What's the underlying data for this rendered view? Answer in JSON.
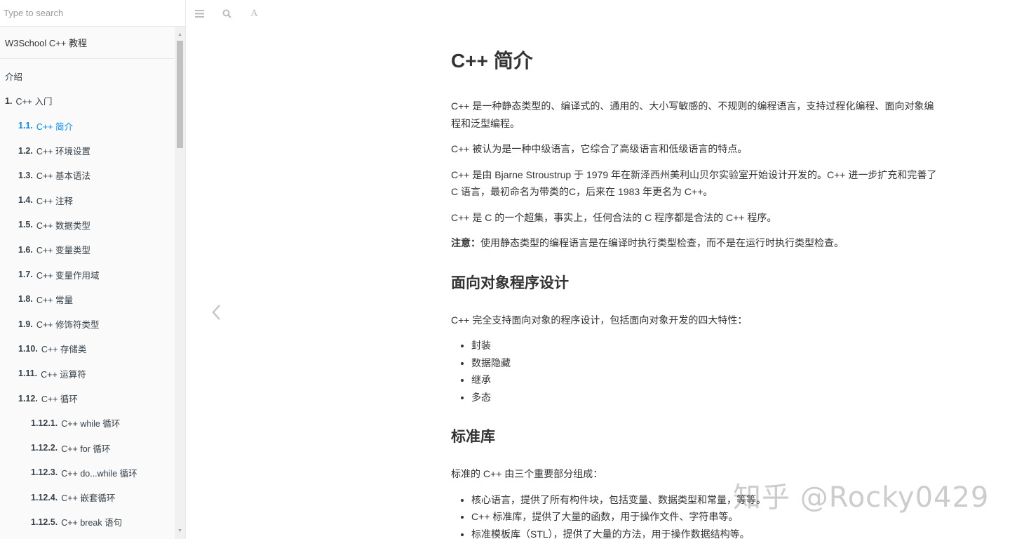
{
  "search": {
    "placeholder": "Type to search"
  },
  "sidebar": {
    "book_title": "W3School C++ 教程",
    "items": [
      {
        "num": "",
        "label": "介绍",
        "level": 0,
        "active": false
      },
      {
        "num": "1.",
        "label": "C++ 入门",
        "level": 0,
        "active": false
      },
      {
        "num": "1.1.",
        "label": "C++ 简介",
        "level": 1,
        "active": true
      },
      {
        "num": "1.2.",
        "label": "C++ 环境设置",
        "level": 1,
        "active": false
      },
      {
        "num": "1.3.",
        "label": "C++ 基本语法",
        "level": 1,
        "active": false
      },
      {
        "num": "1.4.",
        "label": "C++ 注释",
        "level": 1,
        "active": false
      },
      {
        "num": "1.5.",
        "label": "C++ 数据类型",
        "level": 1,
        "active": false
      },
      {
        "num": "1.6.",
        "label": "C++ 变量类型",
        "level": 1,
        "active": false
      },
      {
        "num": "1.7.",
        "label": "C++ 变量作用域",
        "level": 1,
        "active": false
      },
      {
        "num": "1.8.",
        "label": "C++ 常量",
        "level": 1,
        "active": false
      },
      {
        "num": "1.9.",
        "label": "C++ 修饰符类型",
        "level": 1,
        "active": false
      },
      {
        "num": "1.10.",
        "label": "C++ 存储类",
        "level": 1,
        "active": false
      },
      {
        "num": "1.11.",
        "label": "C++ 运算符",
        "level": 1,
        "active": false
      },
      {
        "num": "1.12.",
        "label": "C++ 循环",
        "level": 1,
        "active": false
      },
      {
        "num": "1.12.1.",
        "label": "C++ while 循环",
        "level": 2,
        "active": false
      },
      {
        "num": "1.12.2.",
        "label": "C++ for 循环",
        "level": 2,
        "active": false
      },
      {
        "num": "1.12.3.",
        "label": "C++ do...while 循环",
        "level": 2,
        "active": false
      },
      {
        "num": "1.12.4.",
        "label": "C++ 嵌套循环",
        "level": 2,
        "active": false
      },
      {
        "num": "1.12.5.",
        "label": "C++ break 语句",
        "level": 2,
        "active": false
      }
    ]
  },
  "toolbar": {
    "menu_icon": "hamburger-icon",
    "search_icon": "search-icon",
    "font_icon": "font-settings-icon",
    "font_glyph": "A"
  },
  "colors": {
    "accent": "#008cff",
    "text": "#333333",
    "sidebar_bg": "#fafafa"
  },
  "article": {
    "title": "C++ 简介",
    "intro_paragraphs": [
      "C++ 是一种静态类型的、编译式的、通用的、大小写敏感的、不规则的编程语言，支持过程化编程、面向对象编程和泛型编程。",
      "C++ 被认为是一种中级语言，它综合了高级语言和低级语言的特点。",
      "C++ 是由 Bjarne Stroustrup 于 1979 年在新泽西州美利山贝尔实验室开始设计开发的。C++ 进一步扩充和完善了 C 语言，最初命名为带类的C，后来在 1983 年更名为 C++。",
      "C++ 是 C 的一个超集，事实上，任何合法的 C 程序都是合法的 C++ 程序。"
    ],
    "note_label": "注意：",
    "note_text": "使用静态类型的编程语言是在编译时执行类型检查，而不是在运行时执行类型检查。",
    "oop_heading": "面向对象程序设计",
    "oop_intro": "C++ 完全支持面向对象的程序设计，包括面向对象开发的四大特性：",
    "oop_features": [
      "封装",
      "数据隐藏",
      "继承",
      "多态"
    ],
    "stdlib_heading": "标准库",
    "stdlib_intro": "标准的 C++ 由三个重要部分组成：",
    "stdlib_parts": [
      "核心语言，提供了所有构件块，包括变量、数据类型和常量，等等。",
      "C++ 标准库，提供了大量的函数，用于操作文件、字符串等。",
      "标准模板库（STL），提供了大量的方法，用于操作数据结构等。"
    ]
  },
  "watermark": "知乎 @Rocky0429"
}
